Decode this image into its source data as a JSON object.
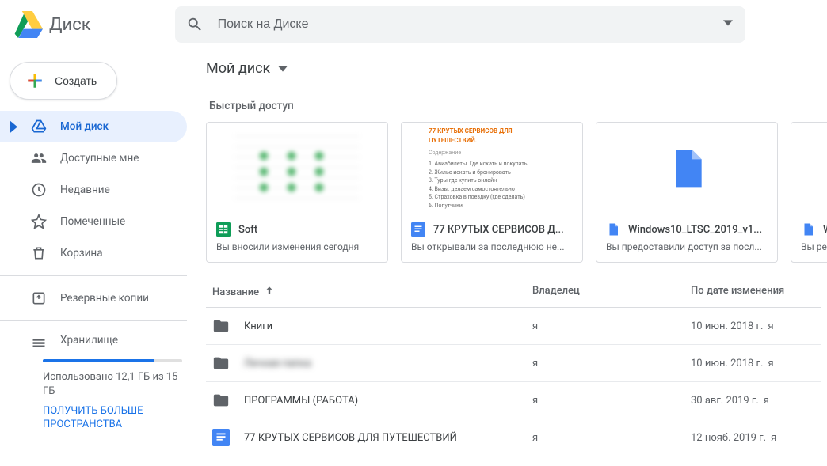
{
  "app": {
    "name": "Диск"
  },
  "search": {
    "placeholder": "Поиск на Диске"
  },
  "sidebar": {
    "create_label": "Создать",
    "items": [
      {
        "label": "Мой диск"
      },
      {
        "label": "Доступные мне"
      },
      {
        "label": "Недавние"
      },
      {
        "label": "Помеченные"
      },
      {
        "label": "Корзина"
      },
      {
        "label": "Резервные копии"
      },
      {
        "label": "Хранилище"
      }
    ],
    "storage": {
      "used_text": "Использовано 12,1 ГБ из 15 ГБ",
      "upgrade_text": "ПОЛУЧИТЬ БОЛЬШЕ ПРОСТРАНСТВА"
    }
  },
  "main": {
    "title": "Мой диск",
    "quick_label": "Быстрый доступ",
    "quick": [
      {
        "name": "Soft",
        "sub": "Вы вносили изменения сегодня",
        "type": "sheets"
      },
      {
        "name": "77 КРУТЫХ СЕРВИСОВ Д...",
        "sub": "Вы открывали за последнюю не...",
        "type": "docs",
        "doc_title": "77 КРУТЫХ СЕРВИСОВ ДЛЯ ПУТЕШЕСТВИЙ.",
        "doc_sub": "Содержание"
      },
      {
        "name": "Windows10_LTSC_2019_v1...",
        "sub": "Вы предоставили доступ за посл...",
        "type": "file"
      },
      {
        "name": "W",
        "sub": "Вы ре",
        "type": "file"
      }
    ],
    "columns": {
      "name": "Название",
      "owner": "Владелец",
      "date": "По дате изменения"
    },
    "rows": [
      {
        "name": "Книги",
        "owner": "я",
        "date": "10 июн. 2018 г.",
        "me": "я",
        "type": "folder"
      },
      {
        "name": "Личная папка",
        "owner": "я",
        "date": "10 июн. 2018 г.",
        "me": "я",
        "type": "folder",
        "blurred": true
      },
      {
        "name": "ПРОГРАММЫ (РАБОТА)",
        "owner": "я",
        "date": "30 авг. 2019 г.",
        "me": "я",
        "type": "folder"
      },
      {
        "name": "77 КРУТЫХ СЕРВИСОВ ДЛЯ ПУТЕШЕСТВИЙ",
        "owner": "я",
        "date": "12 нояб. 2019 г.",
        "me": "я",
        "type": "docs"
      }
    ]
  }
}
